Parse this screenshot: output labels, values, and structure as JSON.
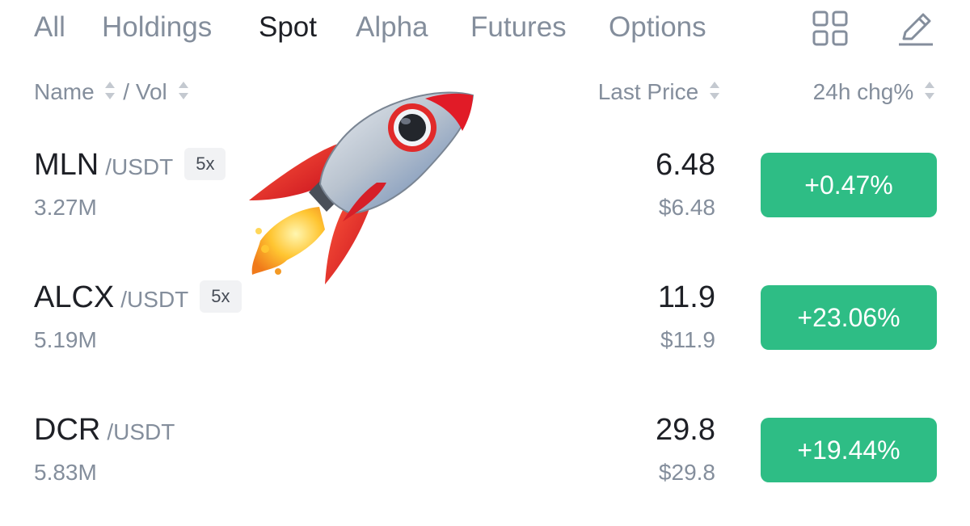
{
  "tabs": [
    {
      "label": "All",
      "active": false
    },
    {
      "label": "Holdings",
      "active": false
    },
    {
      "label": "Spot",
      "active": true
    },
    {
      "label": "Alpha",
      "active": false
    },
    {
      "label": "Futures",
      "active": false
    },
    {
      "label": "Options",
      "active": false
    }
  ],
  "toolbar": {
    "grid_icon": "grid-icon",
    "edit_icon": "edit-pencil-icon"
  },
  "columns": {
    "name": "Name",
    "separator": "/",
    "vol": "Vol",
    "last_price": "Last Price",
    "change": "24h chg%"
  },
  "rows": [
    {
      "base": "MLN",
      "quote": "/USDT",
      "leverage": "5x",
      "volume": "3.27M",
      "last_price": "6.48",
      "fiat_price": "$6.48",
      "change": "+0.47%"
    },
    {
      "base": "ALCX",
      "quote": "/USDT",
      "leverage": "5x",
      "volume": "5.19M",
      "last_price": "11.9",
      "fiat_price": "$11.9",
      "change": "+23.06%"
    },
    {
      "base": "DCR",
      "quote": "/USDT",
      "leverage": "",
      "volume": "5.83M",
      "last_price": "29.8",
      "fiat_price": "$29.8",
      "change": "+19.44%"
    }
  ],
  "colors": {
    "positive": "#2ebd85",
    "text_primary": "#1e2026",
    "text_secondary": "#848e9c",
    "badge_bg": "#f1f2f4"
  },
  "overlay": {
    "emoji": "rocket"
  }
}
